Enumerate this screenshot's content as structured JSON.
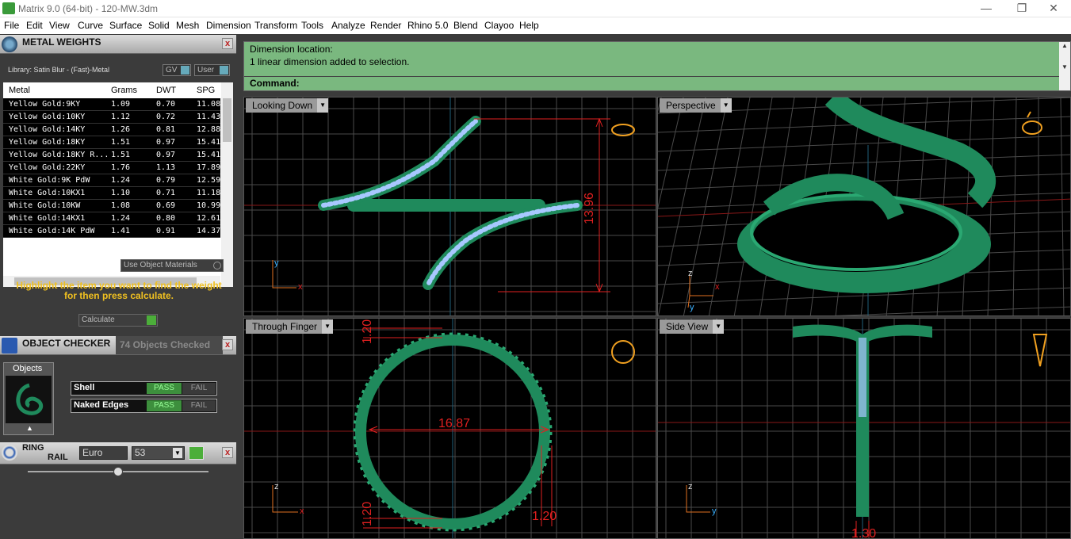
{
  "window": {
    "title": "Matrix 9.0 (64-bit) - 120-MW.3dm",
    "minimize": "—",
    "restore": "❐",
    "close": "✕"
  },
  "menu": [
    "File",
    "Edit",
    "View",
    "Curve",
    "Surface",
    "Solid",
    "Mesh",
    "Dimension",
    "Transform",
    "Tools",
    "Analyze",
    "Render",
    "Rhino 5.0",
    "Blend",
    "Clayoo",
    "Help"
  ],
  "metal_weights": {
    "title": "METAL WEIGHTS",
    "library": "Library: Satin Blur - (Fast)-Metal",
    "gv_label": "GV",
    "user_label": "User",
    "columns": [
      "Metal",
      "Grams",
      "DWT",
      "SPG"
    ],
    "rows": [
      [
        "Yellow Gold:9KY",
        "1.09",
        "0.70",
        "11.08"
      ],
      [
        "Yellow Gold:10KY",
        "1.12",
        "0.72",
        "11.43"
      ],
      [
        "Yellow Gold:14KY",
        "1.26",
        "0.81",
        "12.88"
      ],
      [
        "Yellow Gold:18KY",
        "1.51",
        "0.97",
        "15.41"
      ],
      [
        "Yellow Gold:18KY R...",
        "1.51",
        "0.97",
        "15.41"
      ],
      [
        "Yellow Gold:22KY",
        "1.76",
        "1.13",
        "17.89"
      ],
      [
        "White Gold:9K PdW",
        "1.24",
        "0.79",
        "12.59"
      ],
      [
        "White Gold:10KX1",
        "1.10",
        "0.71",
        "11.18"
      ],
      [
        "White Gold:10KW",
        "1.08",
        "0.69",
        "10.99"
      ],
      [
        "White Gold:14KX1",
        "1.24",
        "0.80",
        "12.61"
      ],
      [
        "White Gold:14K PdW",
        "1.41",
        "0.91",
        "14.37"
      ]
    ],
    "use_object_materials": "Use Object Materials",
    "hint": "Highlight the item you want to find the weight for then press calculate.",
    "calculate": "Calculate"
  },
  "object_checker": {
    "title": "OBJECT CHECKER",
    "status": "74  Objects Checked",
    "objects_label": "Objects",
    "checks": [
      {
        "name": "Shell",
        "pass": "PASS",
        "fail": "FAIL"
      },
      {
        "name": "Naked Edges",
        "pass": "PASS",
        "fail": "FAIL"
      }
    ]
  },
  "ring_rail": {
    "title_line1": "RING",
    "title_line2": "RAIL",
    "standard": "Euro",
    "size": "53"
  },
  "command": {
    "line1": "Dimension location:",
    "line2": "1 linear dimension added to selection.",
    "prompt": "Command:"
  },
  "viewports": {
    "top_left": {
      "label": "Looking Down",
      "dim": "13.96",
      "axis_v": "y",
      "axis_h": "x"
    },
    "top_right": {
      "label": "Perspective",
      "axis_v": "z",
      "axis_h": "x",
      "axis_d": "y"
    },
    "bottom_left": {
      "label": "Through Finger",
      "dim_diameter": "16.87",
      "dim_top": "1.20",
      "dim_bottom": "1.20",
      "dim_right": "1.20",
      "axis_v": "z",
      "axis_h": "x"
    },
    "bottom_right": {
      "label": "Side View",
      "dim_bottom": "1.30",
      "axis_v": "z",
      "axis_h": "y"
    }
  },
  "colors": {
    "accent_green": "#7ab87f",
    "ring_green": "#1f8a5c",
    "stone_blue": "#a8c8ff",
    "dimension_red": "#e02020",
    "hint_yellow": "#f0c020"
  }
}
